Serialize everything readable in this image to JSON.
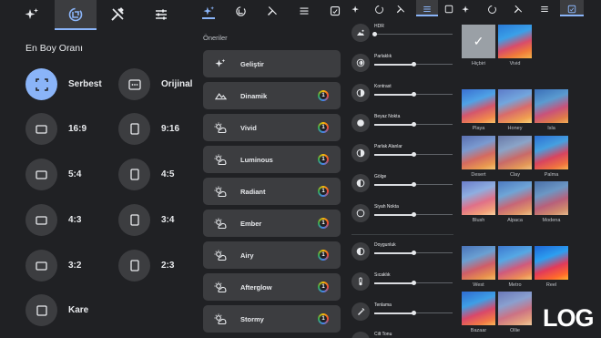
{
  "panel1": {
    "title": "En Boy Oranı",
    "tabs": [
      "auto-fix-icon",
      "crop-rotate-icon",
      "tools-icon",
      "adjust-sliders-icon"
    ],
    "options": [
      {
        "label": "Serbest",
        "selected": true,
        "icon": "freeform-crop-icon"
      },
      {
        "label": "Orijinal",
        "selected": false,
        "icon": "original-ratio-icon"
      },
      {
        "label": "16:9",
        "selected": false,
        "icon": "landscape-ratio-icon"
      },
      {
        "label": "9:16",
        "selected": false,
        "icon": "portrait-ratio-icon"
      },
      {
        "label": "5:4",
        "selected": false,
        "icon": "landscape-ratio-icon"
      },
      {
        "label": "4:5",
        "selected": false,
        "icon": "portrait-ratio-icon"
      },
      {
        "label": "4:3",
        "selected": false,
        "icon": "landscape-ratio-icon"
      },
      {
        "label": "3:4",
        "selected": false,
        "icon": "portrait-ratio-icon"
      },
      {
        "label": "3:2",
        "selected": false,
        "icon": "landscape-ratio-icon"
      },
      {
        "label": "2:3",
        "selected": false,
        "icon": "portrait-ratio-icon"
      },
      {
        "label": "Kare",
        "selected": false,
        "icon": "square-ratio-icon"
      }
    ]
  },
  "panel2": {
    "subtitle": "Öneriler",
    "items": [
      {
        "name": "Geliştir",
        "icon": "sparkle-icon",
        "badge": ""
      },
      {
        "name": "Dinamik",
        "icon": "mountain-icon",
        "badge": "1"
      },
      {
        "name": "Vivid",
        "icon": "weather-icon",
        "badge": "1"
      },
      {
        "name": "Luminous",
        "icon": "weather-icon",
        "badge": "1"
      },
      {
        "name": "Radiant",
        "icon": "weather-icon",
        "badge": "1"
      },
      {
        "name": "Ember",
        "icon": "weather-icon",
        "badge": "1"
      },
      {
        "name": "Airy",
        "icon": "weather-icon",
        "badge": "1"
      },
      {
        "name": "Afterglow",
        "icon": "weather-icon",
        "badge": "1"
      },
      {
        "name": "Stormy",
        "icon": "weather-icon",
        "badge": "1"
      }
    ]
  },
  "panel3": {
    "adjustments": [
      {
        "label": "HDR",
        "value": 0.0,
        "icon": "hdr-icon"
      },
      {
        "label": "Parlaklık",
        "value": 0.5,
        "icon": "brightness-icon"
      },
      {
        "label": "Kontrast",
        "value": 0.5,
        "icon": "contrast-icon"
      },
      {
        "label": "Beyaz Nokta",
        "value": 0.5,
        "icon": "white-point-icon"
      },
      {
        "label": "Parlak Alanlar",
        "value": 0.5,
        "icon": "highlights-icon"
      },
      {
        "label": "Gölge",
        "value": 0.5,
        "icon": "shadows-icon"
      },
      {
        "label": "Siyah Nokta",
        "value": 0.5,
        "icon": "black-point-icon"
      },
      {
        "label": "Doygunluk",
        "value": 0.5,
        "icon": "saturation-icon"
      },
      {
        "label": "Sıcaklık",
        "value": 0.5,
        "icon": "temperature-icon"
      },
      {
        "label": "Tenlama",
        "value": 0.5,
        "icon": "tint-icon"
      },
      {
        "label": "Cilt Tonu",
        "value": 0.5,
        "icon": "skin-tone-icon"
      }
    ]
  },
  "panel4": {
    "filters": [
      "Hiçbiri",
      "Vivid",
      "Playa",
      "Honey",
      "Isla",
      "Desert",
      "Clay",
      "Palma",
      "Blush",
      "Alpaca",
      "Modena",
      "West",
      "Metro",
      "Reel",
      "Bazaar",
      "Ollie"
    ]
  },
  "logo": "LOG"
}
